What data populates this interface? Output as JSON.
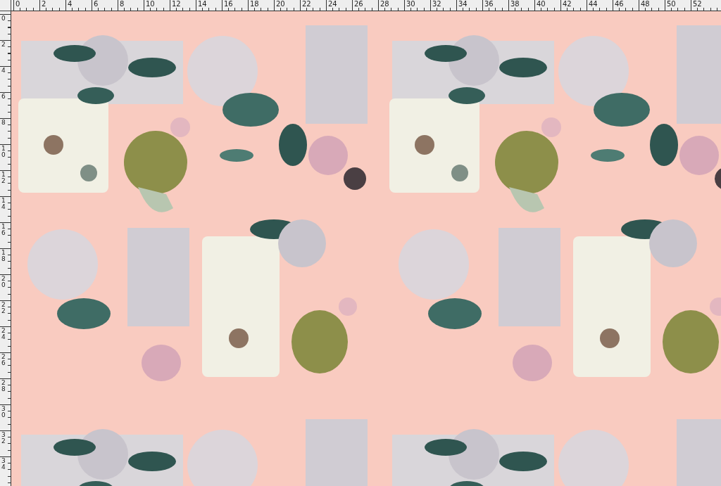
{
  "top_ruler": {
    "labels": [
      "0",
      "2",
      "4",
      "6",
      "8",
      "10",
      "12",
      "14",
      "16",
      "18",
      "20",
      "22",
      "24",
      "26",
      "28",
      "30",
      "32",
      "34",
      "36",
      "38",
      "40",
      "42",
      "44",
      "46",
      "48",
      "50",
      "52"
    ]
  },
  "left_ruler": {
    "labels": [
      "0",
      "2",
      "4",
      "6",
      "8",
      "10",
      "12",
      "14",
      "16",
      "18",
      "20",
      "22",
      "24",
      "26",
      "28",
      "30",
      "32",
      "34"
    ]
  }
}
